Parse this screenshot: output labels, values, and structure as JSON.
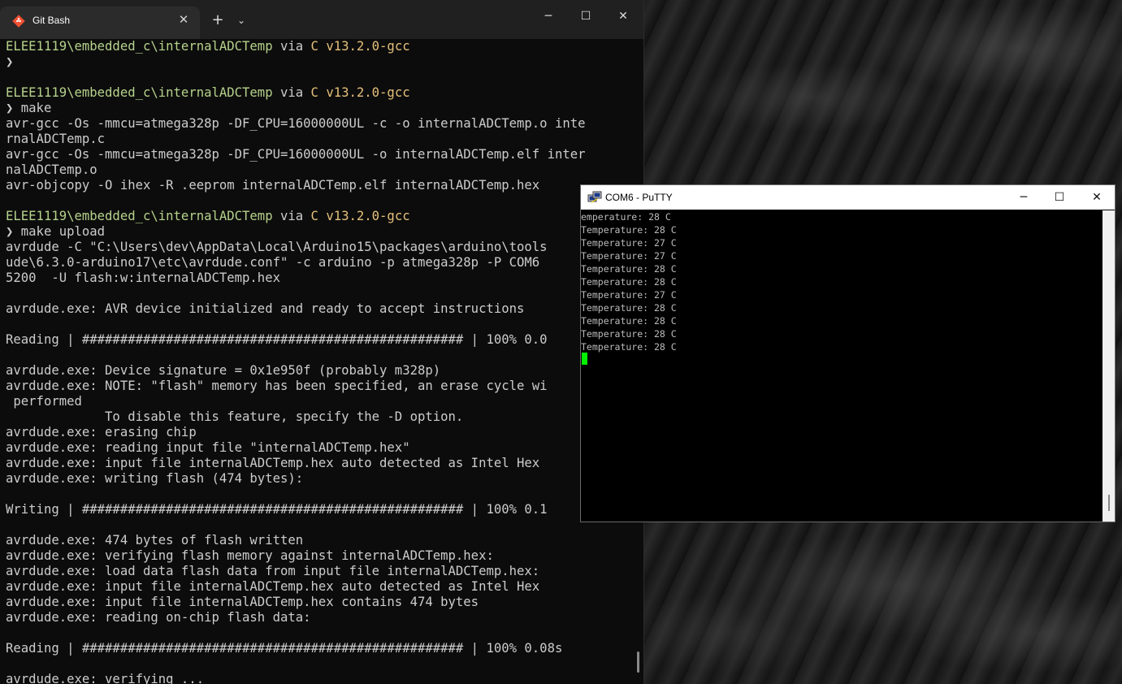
{
  "gitbash": {
    "tab_title": "Git Bash",
    "tab_close": "✕",
    "new_tab": "+",
    "dropdown": "⌄",
    "minimize": "─",
    "maximize": "☐",
    "close": "✕",
    "lines": [
      {
        "type": "prompt-path",
        "path": "ELEE1119\\embedded_c\\internalADCTemp",
        "via": " via ",
        "lang": "C v13.2.0-gcc"
      },
      {
        "type": "text",
        "text": "❯"
      },
      {
        "type": "text",
        "text": ""
      },
      {
        "type": "prompt-path",
        "path": "ELEE1119\\embedded_c\\internalADCTemp",
        "via": " via ",
        "lang": "C v13.2.0-gcc"
      },
      {
        "type": "text",
        "text": "❯ make"
      },
      {
        "type": "text",
        "text": "avr-gcc -Os -mmcu=atmega328p -DF_CPU=16000000UL -c -o internalADCTemp.o inte"
      },
      {
        "type": "text",
        "text": "rnalADCTemp.c"
      },
      {
        "type": "text",
        "text": "avr-gcc -Os -mmcu=atmega328p -DF_CPU=16000000UL -o internalADCTemp.elf inter"
      },
      {
        "type": "text",
        "text": "nalADCTemp.o"
      },
      {
        "type": "text",
        "text": "avr-objcopy -O ihex -R .eeprom internalADCTemp.elf internalADCTemp.hex"
      },
      {
        "type": "text",
        "text": ""
      },
      {
        "type": "prompt-path",
        "path": "ELEE1119\\embedded_c\\internalADCTemp",
        "via": " via ",
        "lang": "C v13.2.0-gcc"
      },
      {
        "type": "text",
        "text": "❯ make upload"
      },
      {
        "type": "text",
        "text": "avrdude -C \"C:\\Users\\dev\\AppData\\Local\\Arduino15\\packages\\arduino\\tools"
      },
      {
        "type": "text",
        "text": "ude\\6.3.0-arduino17\\etc\\avrdude.conf\" -c arduino -p atmega328p -P COM6"
      },
      {
        "type": "text",
        "text": "5200  -U flash:w:internalADCTemp.hex"
      },
      {
        "type": "text",
        "text": ""
      },
      {
        "type": "text",
        "text": "avrdude.exe: AVR device initialized and ready to accept instructions"
      },
      {
        "type": "text",
        "text": ""
      },
      {
        "type": "text",
        "text": "Reading | ################################################## | 100% 0.0"
      },
      {
        "type": "text",
        "text": ""
      },
      {
        "type": "text",
        "text": "avrdude.exe: Device signature = 0x1e950f (probably m328p)"
      },
      {
        "type": "text",
        "text": "avrdude.exe: NOTE: \"flash\" memory has been specified, an erase cycle wi"
      },
      {
        "type": "text",
        "text": " performed"
      },
      {
        "type": "text",
        "text": "             To disable this feature, specify the -D option."
      },
      {
        "type": "text",
        "text": "avrdude.exe: erasing chip"
      },
      {
        "type": "text",
        "text": "avrdude.exe: reading input file \"internalADCTemp.hex\""
      },
      {
        "type": "text",
        "text": "avrdude.exe: input file internalADCTemp.hex auto detected as Intel Hex"
      },
      {
        "type": "text",
        "text": "avrdude.exe: writing flash (474 bytes):"
      },
      {
        "type": "text",
        "text": ""
      },
      {
        "type": "text",
        "text": "Writing | ################################################## | 100% 0.1"
      },
      {
        "type": "text",
        "text": ""
      },
      {
        "type": "text",
        "text": "avrdude.exe: 474 bytes of flash written"
      },
      {
        "type": "text",
        "text": "avrdude.exe: verifying flash memory against internalADCTemp.hex:"
      },
      {
        "type": "text",
        "text": "avrdude.exe: load data flash data from input file internalADCTemp.hex:"
      },
      {
        "type": "text",
        "text": "avrdude.exe: input file internalADCTemp.hex auto detected as Intel Hex"
      },
      {
        "type": "text",
        "text": "avrdude.exe: input file internalADCTemp.hex contains 474 bytes"
      },
      {
        "type": "text",
        "text": "avrdude.exe: reading on-chip flash data:"
      },
      {
        "type": "text",
        "text": ""
      },
      {
        "type": "text",
        "text": "Reading | ################################################## | 100% 0.08s"
      },
      {
        "type": "text",
        "text": ""
      },
      {
        "type": "text",
        "text": "avrdude.exe: verifying ..."
      }
    ]
  },
  "putty": {
    "title": "COM6 - PuTTY",
    "minimize": "─",
    "maximize": "☐",
    "close": "✕",
    "lines": [
      "emperature: 28 C",
      "Temperature: 28 C",
      "Temperature: 27 C",
      "Temperature: 27 C",
      "Temperature: 28 C",
      "Temperature: 28 C",
      "Temperature: 27 C",
      "Temperature: 28 C",
      "Temperature: 28 C",
      "Temperature: 28 C",
      "Temperature: 28 C"
    ]
  },
  "colors": {
    "path": "#b6d28b",
    "lang": "#e5c07b",
    "cursor": "#00ee00"
  }
}
